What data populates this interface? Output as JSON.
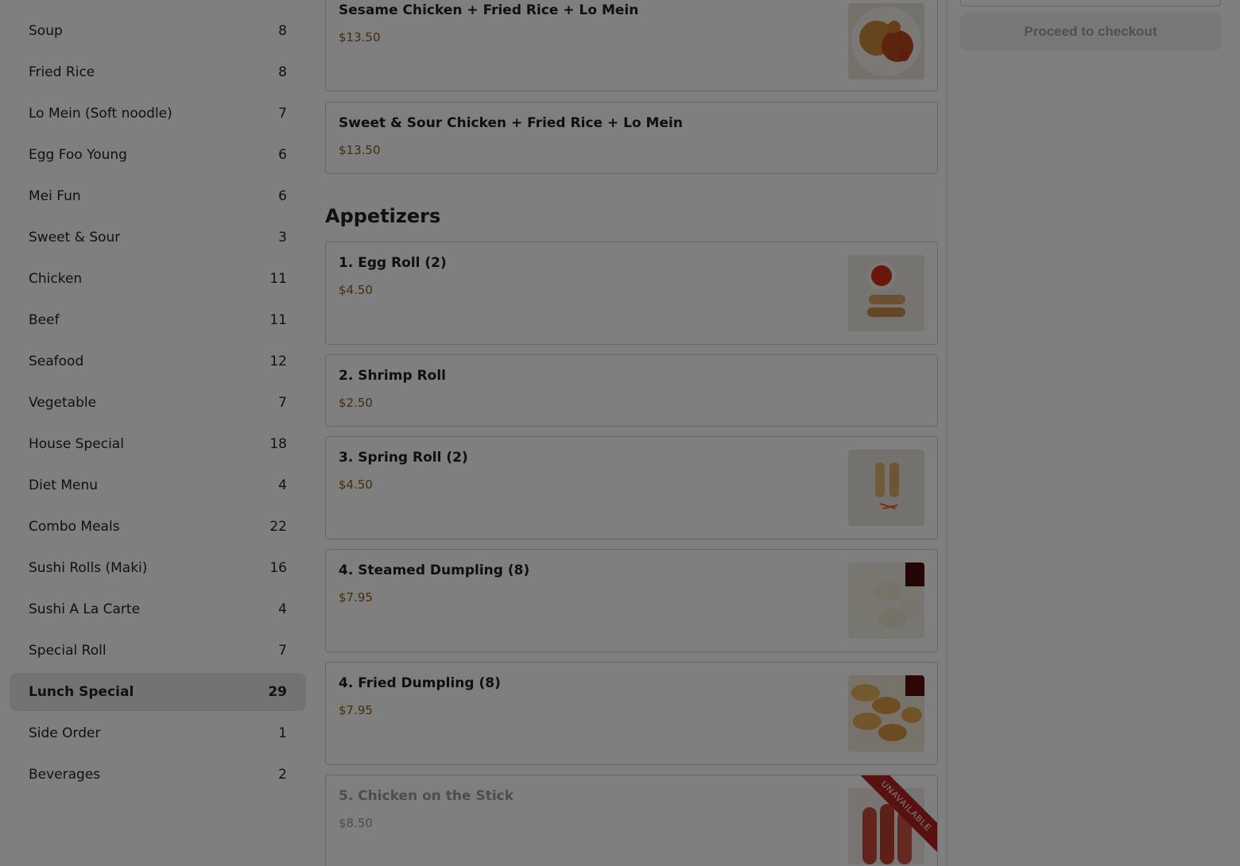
{
  "sidebar": {
    "categories": [
      {
        "label": "Soup",
        "count": "8"
      },
      {
        "label": "Fried Rice",
        "count": "8"
      },
      {
        "label": "Lo Mein (Soft noodle)",
        "count": "7"
      },
      {
        "label": "Egg Foo Young",
        "count": "6"
      },
      {
        "label": "Mei Fun",
        "count": "6"
      },
      {
        "label": "Sweet & Sour",
        "count": "3"
      },
      {
        "label": "Chicken",
        "count": "11"
      },
      {
        "label": "Beef",
        "count": "11"
      },
      {
        "label": "Seafood",
        "count": "12"
      },
      {
        "label": "Vegetable",
        "count": "7"
      },
      {
        "label": "House Special",
        "count": "18"
      },
      {
        "label": "Diet Menu",
        "count": "4"
      },
      {
        "label": "Combo Meals",
        "count": "22"
      },
      {
        "label": "Sushi Rolls (Maki)",
        "count": "16"
      },
      {
        "label": "Sushi A La Carte",
        "count": "4"
      },
      {
        "label": "Special Roll",
        "count": "7"
      },
      {
        "label": "Lunch Special",
        "count": "29"
      },
      {
        "label": "Side Order",
        "count": "1"
      },
      {
        "label": "Beverages",
        "count": "2"
      }
    ],
    "active": "Lunch Special"
  },
  "menu": {
    "top_items": [
      {
        "name": "Sesame Chicken + Fried Rice + Lo Mein",
        "price": "$13.50"
      },
      {
        "name": "Sweet & Sour Chicken + Fried Rice + Lo Mein",
        "price": "$13.50"
      }
    ],
    "section_title": "Appetizers",
    "appetizers": [
      {
        "name": "1. Egg Roll (2)",
        "price": "$4.50"
      },
      {
        "name": "2. Shrimp Roll",
        "price": "$2.50"
      },
      {
        "name": "3. Spring Roll (2)",
        "price": "$4.50"
      },
      {
        "name": "4. Steamed Dumpling (8)",
        "price": "$7.95"
      },
      {
        "name": "4. Fried Dumpling (8)",
        "price": "$7.95"
      },
      {
        "name": "5. Chicken on the Stick",
        "price": "$8.50",
        "badge": "UNAVAILABLE"
      }
    ]
  },
  "cart": {
    "checkout_label": "Proceed to checkout"
  },
  "colors": {
    "price": "#8a5a16",
    "unavailable_badge": "#b32020",
    "active_category_bg": "#e6e6e6"
  }
}
